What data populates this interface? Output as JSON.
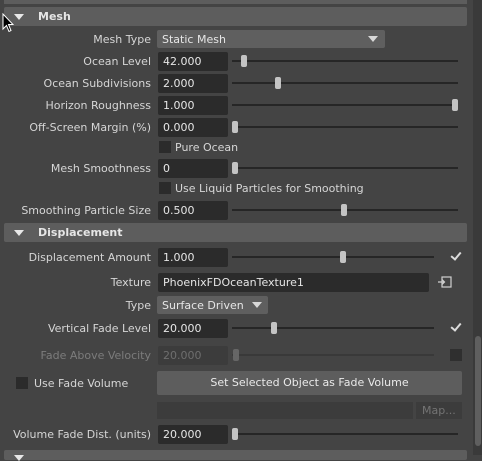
{
  "mesh": {
    "title": "Mesh",
    "mesh_type": {
      "label": "Mesh Type",
      "value": "Static Mesh"
    },
    "ocean_level": {
      "label": "Ocean Level",
      "value": "42.000",
      "slider": 0.06
    },
    "ocean_subdivisions": {
      "label": "Ocean Subdivisions",
      "value": "2.000",
      "slider": 0.2
    },
    "horizon_roughness": {
      "label": "Horizon Roughness",
      "value": "1.000",
      "slider": 1.0
    },
    "offscreen_margin": {
      "label": "Off-Screen Margin (%)",
      "value": "0.000",
      "slider": 0.0
    },
    "pure_ocean": {
      "label": "Pure Ocean",
      "checked": false
    },
    "mesh_smoothness": {
      "label": "Mesh Smoothness",
      "value": "0",
      "slider": 0.0
    },
    "use_liquid": {
      "label": "Use Liquid Particles for Smoothing",
      "checked": false
    },
    "smoothing_particle_size": {
      "label": "Smoothing Particle Size",
      "value": "0.500",
      "slider": 0.49
    }
  },
  "displacement": {
    "title": "Displacement",
    "amount": {
      "label": "Displacement Amount",
      "value": "1.000",
      "slider": 0.5,
      "enabled": true
    },
    "texture": {
      "label": "Texture",
      "value": "PhoenixFDOceanTexture1"
    },
    "type": {
      "label": "Type",
      "value": "Surface Driven"
    },
    "vertical_fade": {
      "label": "Vertical Fade Level",
      "value": "20.000",
      "slider": 0.2,
      "enabled": true
    },
    "fade_above_velocity": {
      "label": "Fade Above Velocity",
      "value": "20.000",
      "slider": 0.0,
      "enabled": false
    },
    "use_fade_volume": {
      "label": "Use Fade Volume",
      "checked": false
    },
    "set_fade_button": "Set Selected Object as Fade Volume",
    "map_button": "Map...",
    "volume_fade_dist": {
      "label": "Volume Fade Dist. (units)",
      "value": "20.000",
      "slider": 0.0
    }
  }
}
